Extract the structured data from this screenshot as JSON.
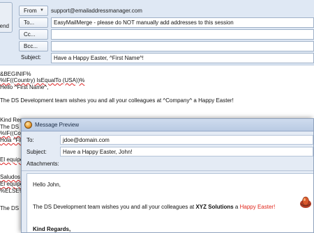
{
  "compose": {
    "send_label": "end",
    "from_label": "From",
    "from_address": "support@emailaddressmanager.com",
    "to_label": "To...",
    "to_value": "EasyMailMerge - please do NOT manually add addresses to this session",
    "cc_label": "Cc...",
    "cc_value": "",
    "bcc_label": "Bcc...",
    "bcc_value": "",
    "subject_label": "Subject:",
    "subject_value": "Have a Happy Easter, ^First Name^!",
    "body_lines": [
      "&BEGINIF%",
      "%IF((Country) IsEqualTo (USA))%",
      "Hello ^First Name^,",
      "",
      "The DS Development team wishes you and all your colleagues at ^Company^ a Happy Easter!",
      "",
      "Kind Rega",
      "The DS D",
      "%IF((Coun",
      "Hola ^Fir",
      "",
      "El equipo",
      "",
      "Saludos c",
      "El equipo",
      "%ELSE%",
      "",
      "The DS D"
    ]
  },
  "preview": {
    "title": "Message Preview",
    "to_label": "To:",
    "to_value": "jdoe@domain.com",
    "subject_label": "Subject:",
    "subject_value": "Have a Happy Easter, John!",
    "attachments_label": "Attachments:",
    "greeting": "Hello John,",
    "message_prefix": "The DS Development team wishes you and all your colleagues at ",
    "company": "XYZ Solutions",
    "message_mid": " a ",
    "message_highlight": "Happy Easter!",
    "closing": "Kind Regards,"
  }
}
